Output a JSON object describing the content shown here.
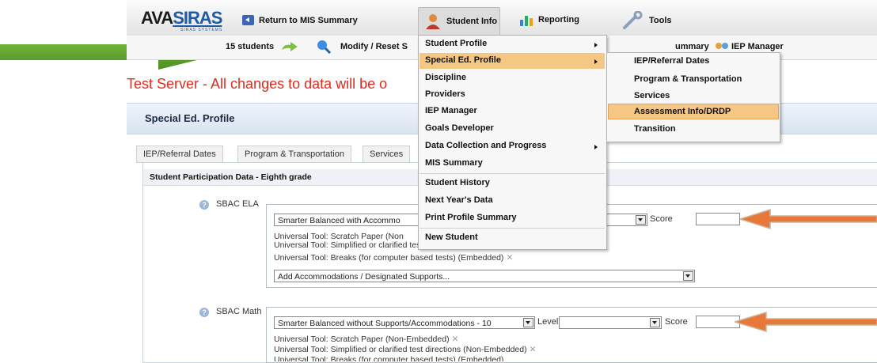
{
  "app": {
    "logo_prefix": "AVA",
    "logo_brand": "SIRAS",
    "logo_subtitle": "SIRAS SYSTEMS"
  },
  "nav": {
    "return_label": "Return to MIS Summary",
    "student_info_label": "Student Info",
    "reporting_label": "Reporting",
    "tools_label": "Tools"
  },
  "subnav": {
    "students_label": "15 students",
    "modify_label": "Modify / Reset S",
    "summary_label": "ummary",
    "iep_manager_label": "IEP Manager"
  },
  "warning": {
    "text": "Test Server - All changes to data will be o"
  },
  "panel": {
    "title": "Special Ed. Profile",
    "tabs": [
      "IEP/Referral Dates",
      "Program & Transportation",
      "Services"
    ],
    "section_title": "Student Participation Data - Eighth grade"
  },
  "sbac_ela": {
    "legend": "SBAC ELA",
    "test_select": "Smarter Balanced with Accommo",
    "score_label": "Score",
    "tools": [
      "Universal Tool: Scratch Paper (Non",
      "Universal Tool: Simplified or clarified test directions (Non-Embedded)",
      "Universal Tool: Breaks (for computer based tests) (Embedded)"
    ],
    "add_select": "Add Accommodations / Designated Supports..."
  },
  "sbac_math": {
    "legend": "SBAC Math",
    "test_select": "Smarter Balanced without Supports/Accommodations - 10",
    "level_label": "Level",
    "score_label": "Score",
    "tools": [
      "Universal Tool: Scratch Paper (Non-Embedded)",
      "Universal Tool: Simplified or clarified test directions (Non-Embedded)",
      "Universal Tool: Breaks (for computer based tests) (Embedded)"
    ]
  },
  "student_info_menu": {
    "items": [
      "Student Profile",
      "Special Ed. Profile",
      "Discipline",
      "Providers",
      "IEP Manager",
      "Goals Developer",
      "Data Collection and Progress",
      "MIS Summary",
      "Student History",
      "Next Year's Data",
      "Print Profile Summary",
      "New Student"
    ]
  },
  "special_ed_submenu": {
    "items": [
      "IEP/Referral Dates",
      "Program & Transportation",
      "Services",
      "Assessment Info/DRDP",
      "Transition"
    ]
  },
  "colors": {
    "menu_highlight": "#f4c785",
    "warning_red": "#e12a1e",
    "arrow_green": "#5a9e2a",
    "arrow_orange": "#e8783a"
  }
}
